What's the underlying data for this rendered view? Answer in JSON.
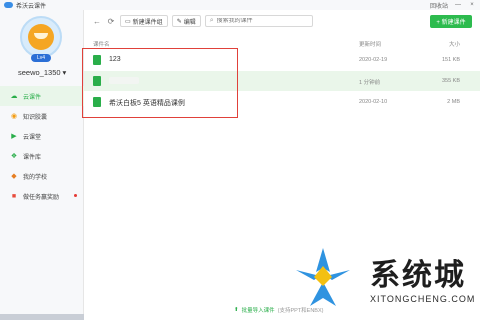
{
  "window": {
    "title": "希沃云课件",
    "right_link": "回收站",
    "min": "—",
    "close": "×"
  },
  "user": {
    "name": "seewo_1350",
    "level": "Lv4"
  },
  "nav": [
    {
      "label": "云课件",
      "icon": "cloud-icon",
      "active": true
    },
    {
      "label": "知识胶囊",
      "icon": "capsule-icon"
    },
    {
      "label": "云课堂",
      "icon": "play-icon"
    },
    {
      "label": "课件库",
      "icon": "library-icon"
    },
    {
      "label": "我的学校",
      "icon": "school-icon"
    },
    {
      "label": "做任务赢奖励",
      "icon": "gift-icon"
    }
  ],
  "toolbar": {
    "new_group": "新建课件组",
    "edit": "编辑",
    "search_placeholder": "搜索我的课件",
    "new_courseware": "+ 新建课件"
  },
  "columns": {
    "name": "课件名",
    "date": "更新时间",
    "size": "大小"
  },
  "files": [
    {
      "name": "123",
      "date": "2020-02-19",
      "size": "151 KB"
    },
    {
      "name": "",
      "date": "1 分钟前",
      "size": "355 KB"
    },
    {
      "name": "希沃白板5 英语精品课例",
      "date": "2020-02-10",
      "size": "2 MB"
    }
  ],
  "footer": {
    "import": "批量导入课件",
    "hint": "(支持PPT和ENBX)"
  },
  "watermark": {
    "text": "系统城",
    "sub": "XITONGCHENG.COM"
  },
  "colors": {
    "accent": "#2dbb4e",
    "highlight": "#eaf6ea",
    "annotation": "#e0413a"
  }
}
